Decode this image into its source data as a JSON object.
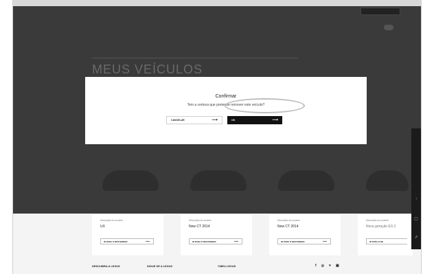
{
  "header": {
    "logo": "",
    "nav_links": [
      "",
      "",
      ""
    ],
    "menu_items": [
      "",
      "",
      "",
      "",
      "",
      ""
    ]
  },
  "breadcrumb": "",
  "page_title": "MEUS VEÍCULOS",
  "vehicles": [
    {
      "label": "",
      "name": "",
      "desc_label": "Descrição do modelo",
      "desc_value": "UX",
      "button": "IR PARA O DESTENDER",
      "button_arrow": "—"
    },
    {
      "label": "",
      "name": "",
      "desc_label": "Descrição do modelo",
      "desc_value": "New CT 2014",
      "button": "IR PARA O DESTENDER",
      "button_arrow": "—"
    },
    {
      "label": "",
      "name": "",
      "desc_label": "Descrição do modelo",
      "desc_value": "New CT 2014",
      "button": "IR PARA O DESTENDER",
      "button_arrow": "—"
    },
    {
      "label": "",
      "name": "",
      "desc_label": "Descrição do modelo",
      "desc_value": "Nova geração ES 2",
      "button": "IR PARA O DE",
      "button_arrow": ""
    }
  ],
  "modal": {
    "title": "Confirmar",
    "text": "Tem a certeza que pretende remover este veículo?",
    "cancel_label": "CANCELAR",
    "ok_label": "OK",
    "arrow": "⟶"
  },
  "footer": {
    "discover": "DESCUBRA A LEXUS",
    "follow": "SIGUE SE A LEXUS",
    "mylexus": "©MEU LEXUS",
    "social_icons": [
      "f",
      "◎",
      "♥",
      "▣"
    ]
  },
  "side_rail": {
    "icon1": "↑",
    "icon2": "▢",
    "icon3": "⇗"
  }
}
